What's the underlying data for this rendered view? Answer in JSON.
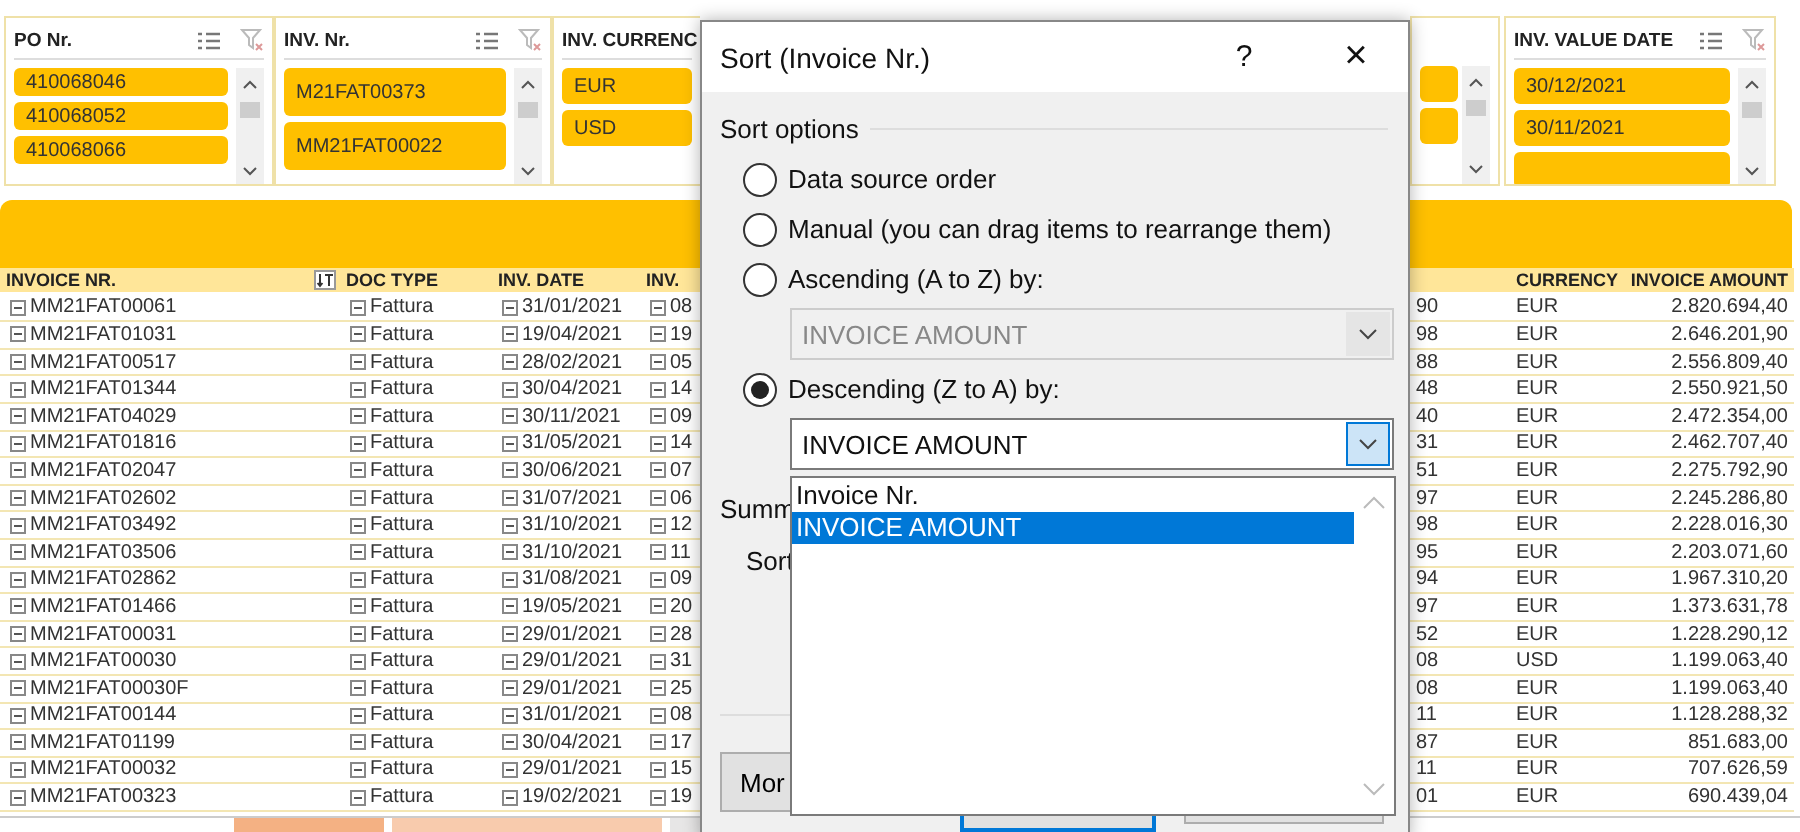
{
  "slicers": [
    {
      "title": "PO Nr.",
      "kind": "compact",
      "items": [
        "410068046",
        "410068052",
        "410068066"
      ],
      "partial_item": false
    },
    {
      "title": "INV. Nr.",
      "kind": "tall",
      "items": [
        "M21FAT00373",
        "MM21FAT00022"
      ],
      "partial_item": false
    },
    {
      "title": "INV. CURRENC",
      "kind": "normal",
      "items": [
        "EUR",
        "USD"
      ],
      "partial_item": false
    },
    {
      "title": "INV. VALUE DATE",
      "kind": "normal",
      "items": [
        "30/12/2021",
        "30/11/2021"
      ],
      "partial_item": true
    }
  ],
  "table": {
    "columns": [
      {
        "label": "INVOICE NR.",
        "kind": "sorted"
      },
      {
        "label": "DOC TYPE",
        "kind": "tree"
      },
      {
        "label": "INV. DATE",
        "kind": "tree"
      },
      {
        "label": "INV.",
        "kind": "tree"
      },
      {
        "kind": "plain"
      },
      {
        "label": "CURRENCY",
        "kind": "plain"
      },
      {
        "label": "INVOICE AMOUNT",
        "kind": "plain"
      }
    ],
    "rows": [
      [
        "MM21FAT00061",
        "Fattura",
        "31/01/2021",
        "08",
        "90",
        "EUR",
        "2.820.694,40"
      ],
      [
        "MM21FAT01031",
        "Fattura",
        "19/04/2021",
        "19",
        "98",
        "EUR",
        "2.646.201,90"
      ],
      [
        "MM21FAT00517",
        "Fattura",
        "28/02/2021",
        "05",
        "88",
        "EUR",
        "2.556.809,40"
      ],
      [
        "MM21FAT01344",
        "Fattura",
        "30/04/2021",
        "14",
        "48",
        "EUR",
        "2.550.921,50"
      ],
      [
        "MM21FAT04029",
        "Fattura",
        "30/11/2021",
        "09",
        "40",
        "EUR",
        "2.472.354,00"
      ],
      [
        "MM21FAT01816",
        "Fattura",
        "31/05/2021",
        "14",
        "31",
        "EUR",
        "2.462.707,40"
      ],
      [
        "MM21FAT02047",
        "Fattura",
        "30/06/2021",
        "07",
        "51",
        "EUR",
        "2.275.792,90"
      ],
      [
        "MM21FAT02602",
        "Fattura",
        "31/07/2021",
        "06",
        "97",
        "EUR",
        "2.245.286,80"
      ],
      [
        "MM21FAT03492",
        "Fattura",
        "31/10/2021",
        "12",
        "98",
        "EUR",
        "2.228.016,30"
      ],
      [
        "MM21FAT03506",
        "Fattura",
        "31/10/2021",
        "11",
        "95",
        "EUR",
        "2.203.071,60"
      ],
      [
        "MM21FAT02862",
        "Fattura",
        "31/08/2021",
        "09",
        "94",
        "EUR",
        "1.967.310,20"
      ],
      [
        "MM21FAT01466",
        "Fattura",
        "19/05/2021",
        "20",
        "97",
        "EUR",
        "1.373.631,78"
      ],
      [
        "MM21FAT00031",
        "Fattura",
        "29/01/2021",
        "28",
        "52",
        "EUR",
        "1.228.290,12"
      ],
      [
        "MM21FAT00030",
        "Fattura",
        "29/01/2021",
        "31",
        "08",
        "USD",
        "1.199.063,40"
      ],
      [
        "MM21FAT00030F",
        "Fattura",
        "29/01/2021",
        "25",
        "08",
        "EUR",
        "1.199.063,40"
      ],
      [
        "MM21FAT00144",
        "Fattura",
        "31/01/2021",
        "08",
        "11",
        "EUR",
        "1.128.288,32"
      ],
      [
        "MM21FAT01199",
        "Fattura",
        "30/04/2021",
        "17",
        "87",
        "EUR",
        "851.683,00"
      ],
      [
        "MM21FAT00032",
        "Fattura",
        "29/01/2021",
        "15",
        "11",
        "EUR",
        "707.626,59"
      ],
      [
        "MM21FAT00323",
        "Fattura",
        "19/02/2021",
        "19",
        "01",
        "EUR",
        "690.439,04"
      ]
    ]
  },
  "dialog": {
    "title": "Sort (Invoice Nr.)",
    "help": "?",
    "close": "×",
    "section": "Sort options",
    "options": [
      {
        "label": "Data source order",
        "selected": false
      },
      {
        "label": "Manual (you can drag items to rearrange them)",
        "selected": false
      },
      {
        "label": "Ascending (A to Z) by:",
        "selected": false,
        "combo": {
          "value": "INVOICE AMOUNT",
          "disabled": true,
          "expanded": false
        }
      },
      {
        "label": "Descending (Z to A) by:",
        "selected": true,
        "combo": {
          "value": "INVOICE AMOUNT",
          "disabled": false,
          "expanded": true,
          "list": [
            {
              "label": "Invoice Nr.",
              "selected": false
            },
            {
              "label": "INVOICE AMOUNT",
              "selected": true
            }
          ]
        }
      }
    ],
    "summary_label": "Summ",
    "sort_label": "Sort",
    "buttons": [
      {
        "kind": "normal",
        "label": "Mor"
      },
      {
        "kind": "primary"
      },
      {
        "kind": "normal"
      }
    ]
  }
}
